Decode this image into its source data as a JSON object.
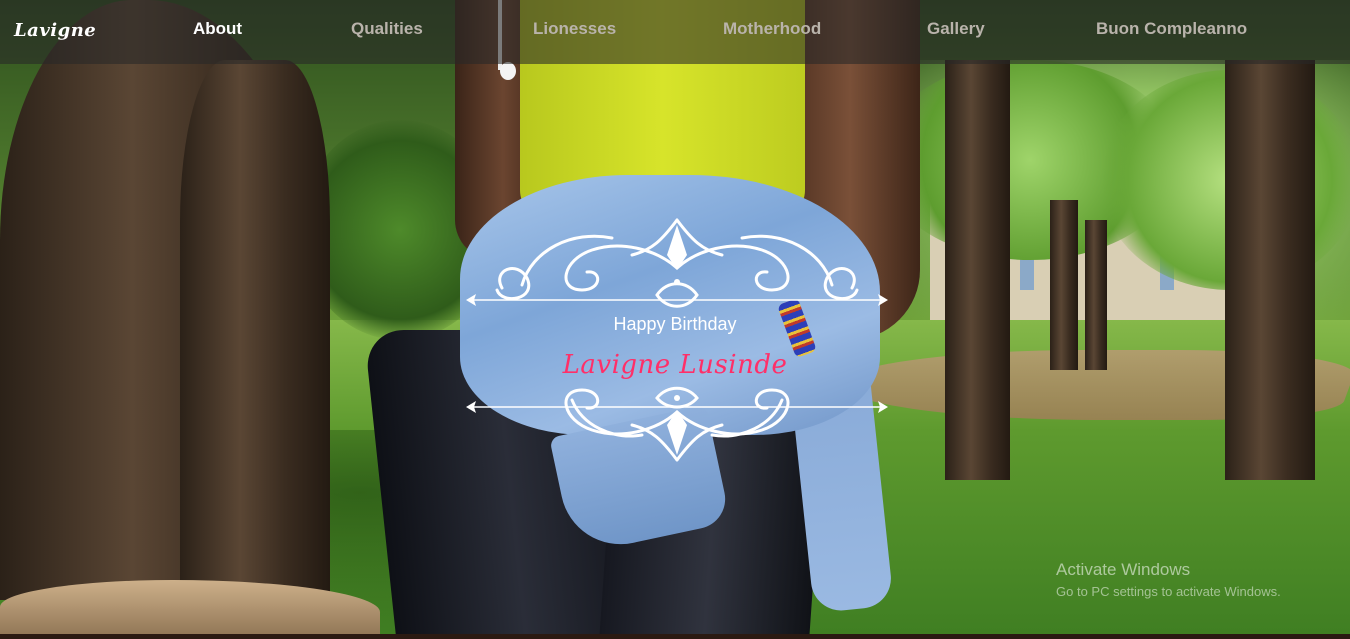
{
  "brand": "Lavigne",
  "nav": {
    "items": [
      {
        "label": "About",
        "active": true
      },
      {
        "label": "Qualities",
        "active": false
      },
      {
        "label": "Lionesses",
        "active": false
      },
      {
        "label": "Motherhood",
        "active": false
      },
      {
        "label": "Gallery",
        "active": false
      },
      {
        "label": "Buon Compleanno",
        "active": false
      }
    ]
  },
  "hero": {
    "greeting": "Happy Birthday",
    "name": "Lavigne Lusinde"
  },
  "watermark": {
    "title": "Activate Windows",
    "subtitle": "Go to PC settings to activate Windows."
  },
  "colors": {
    "name_accent": "#ff2f68",
    "nav_active": "#ffffff",
    "nav_inactive": "#b9b3ab"
  }
}
